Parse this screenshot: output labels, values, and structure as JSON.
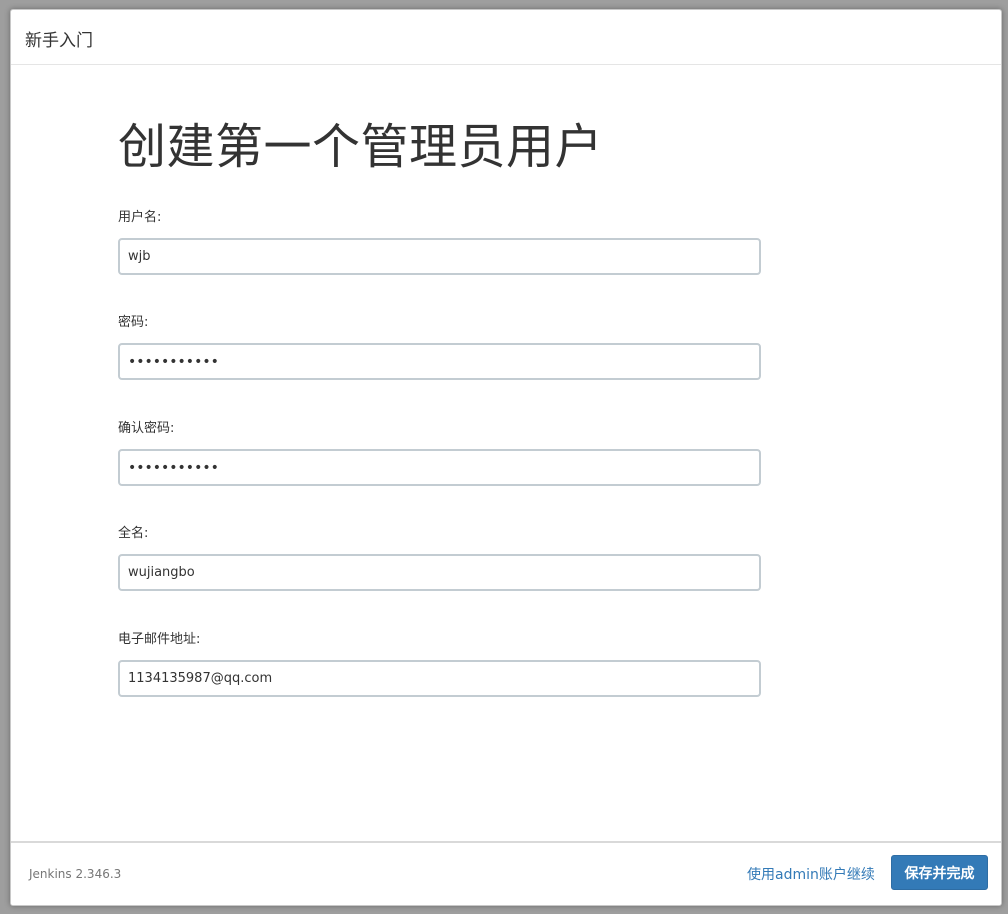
{
  "dialog": {
    "title": "新手入门"
  },
  "main": {
    "heading": "创建第一个管理员用户",
    "fields": [
      {
        "label": "用户名:",
        "value": "wjb",
        "type": "text"
      },
      {
        "label": "密码:",
        "value": "•••••••••••",
        "type": "password"
      },
      {
        "label": "确认密码:",
        "value": "•••••••••••",
        "type": "password"
      },
      {
        "label": "全名:",
        "value": "wujiangbo",
        "type": "text"
      },
      {
        "label": "电子邮件地址:",
        "value": "1134135987@qq.com",
        "type": "text"
      }
    ]
  },
  "footer": {
    "version": "Jenkins 2.346.3",
    "skip_link": "使用admin账户继续",
    "save_button": "保存并完成"
  },
  "colors": {
    "accent": "#337ab7",
    "input_border": "#c3ccd2"
  }
}
